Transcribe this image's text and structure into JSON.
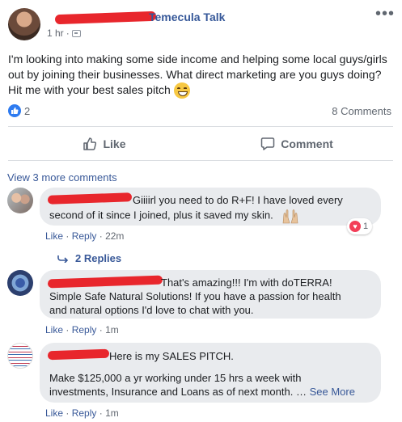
{
  "post": {
    "group_name": "Temecula Talk",
    "time": "1 hr",
    "body": "I'm looking into making some side income and helping some local guys/girls out by joining their businesses. What direct marketing are you guys doing? Hit me with your best sales pitch",
    "like_count": "2",
    "comment_count": "8 Comments",
    "more_icon": "•••"
  },
  "actions": {
    "like_label": "Like",
    "comment_label": "Comment"
  },
  "comments_section": {
    "view_more": "View 3 more comments",
    "comments": [
      {
        "text_line1": "Giiiirl you need to do R+F! I have loved every",
        "text_line2": "second of it since I joined, plus it saved my skin.",
        "like": "Like",
        "reply": "Reply",
        "time": "22m",
        "reaction_count": "1",
        "replies": "2 Replies"
      },
      {
        "text_line1": "That's amazing!!! I'm with doTERRA!",
        "text_line2": "Simple Safe Natural Solutions! If you have a passion for health",
        "text_line3": "and natural options I'd love to chat with you.",
        "like": "Like",
        "reply": "Reply",
        "time": "1m"
      },
      {
        "text_line1": "Here is my SALES PITCH.",
        "text_line2": "Make $125,000 a yr working under 15 hrs a week with",
        "text_line3": "investments, Insurance and Loans as of next month. …",
        "see_more": "See More",
        "like": "Like",
        "reply": "Reply",
        "time": "1m"
      }
    ]
  },
  "colors": {
    "link": "#385898",
    "redaction": "#e8262c",
    "like_blue": "#2e7bf0",
    "heart_red": "#f33e58"
  }
}
